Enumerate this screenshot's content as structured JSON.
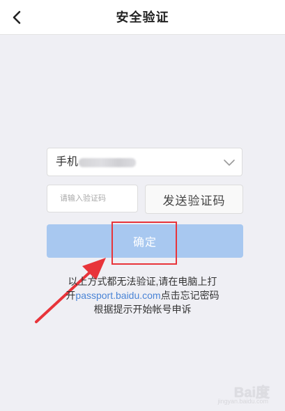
{
  "header": {
    "title": "安全验证",
    "back_icon": "chevron-left-icon"
  },
  "form": {
    "phone_label": "手机",
    "phone_dropdown_icon": "chevron-down-icon",
    "code_placeholder": "请输入验证码",
    "send_code_label": "发送验证码",
    "confirm_label": "确定"
  },
  "help": {
    "line1": "以上方式都无法验证,请在电脑上打",
    "line2_prefix": "开",
    "line2_link": "passport.baidu.com",
    "line2_suffix": "点击忘记密码",
    "line3": "根据提示开始帐号申诉"
  },
  "watermark": {
    "brand": "Bai度",
    "sub": "jingyan.baidu.com"
  },
  "colors": {
    "background": "#efeff4",
    "confirm_button": "#a8c8f0",
    "link": "#4a84d6",
    "annotation": "#e8343a"
  }
}
